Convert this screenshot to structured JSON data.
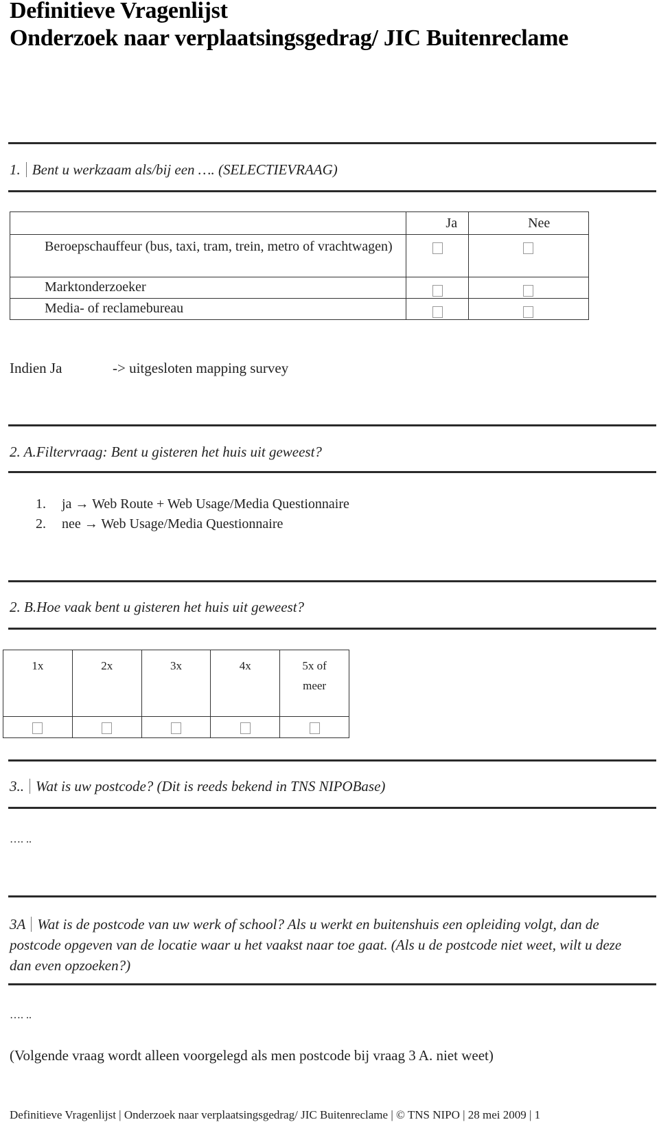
{
  "header": {
    "title_line1": "Definitieve Vragenlijst",
    "title_line2": "Onderzoek naar verplaatsingsgedrag/ JIC Buitenreclame"
  },
  "q1": {
    "number": "1.",
    "text": "Bent u werkzaam als/bij een …. (SELECTIEVRAAG)",
    "table": {
      "columns": [
        "",
        "Ja",
        "Nee"
      ],
      "rows": [
        {
          "label": "Beroepschauffeur (bus, taxi, tram, trein, metro of vrachtwagen)",
          "ja": false,
          "nee": false
        },
        {
          "label": "Marktonderzoeker",
          "ja": false,
          "nee": false
        },
        {
          "label": "Media- of reclamebureau",
          "ja": false,
          "nee": false
        }
      ]
    },
    "condition_label": "Indien Ja",
    "condition_result": "-> uitgesloten mapping survey"
  },
  "q2a": {
    "text": "2. A.Filtervraag: Bent u gisteren het huis uit geweest?",
    "options": [
      {
        "num": "1.",
        "text": "ja → Web Route + Web Usage/Media Questionnaire"
      },
      {
        "num": "2.",
        "text": "nee → Web Usage/Media Questionnaire"
      }
    ]
  },
  "q2b": {
    "text": "2.  B.Hoe vaak bent u gisteren het huis uit geweest?",
    "columns": [
      "1x",
      "2x",
      "3x",
      "4x",
      "5x of meer"
    ],
    "checked": [
      false,
      false,
      false,
      false,
      false
    ]
  },
  "q3": {
    "number": "3..",
    "text": "Wat is uw postcode? (Dit is reeds bekend in TNS NIPOBase)",
    "answer_placeholder": "…. .."
  },
  "q3a": {
    "number": "3A",
    "text": "Wat is  de postcode van uw werk of school? Als u werkt en buitenshuis een opleiding volgt, dan de postcode opgeven van de locatie waar u het vaakst naar toe gaat. (Als u de postcode niet weet, wilt u deze dan even opzoeken?)",
    "answer_placeholder": "…. .."
  },
  "note": "(Volgende vraag wordt alleen voorgelegd als men postcode bij vraag 3 A. niet weet)",
  "footer": "Definitieve Vragenlijst | Onderzoek naar verplaatsingsgedrag/ JIC Buitenreclame | © TNS NIPO | 28 mei 2009 | 1"
}
